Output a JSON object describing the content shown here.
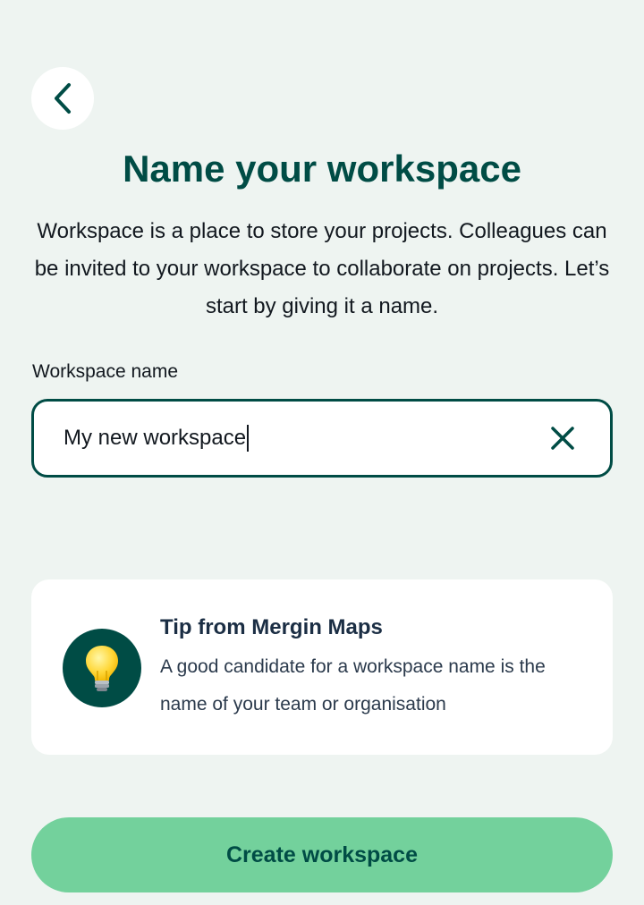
{
  "header": {
    "back_icon": "chevron-left-icon",
    "title": "Name your workspace",
    "description": "Workspace is a place to store your projects. Colleagues can be invited to your workspace to collaborate on projects. Let’s start by giving it a name."
  },
  "form": {
    "label": "Workspace name",
    "value": "My new workspace",
    "clear_icon": "close-icon"
  },
  "tip": {
    "icon": "lightbulb-icon",
    "title": "Tip from Mergin Maps",
    "text": "A good candidate for a workspace name is the name of your team or organisation"
  },
  "actions": {
    "create_label": "Create workspace"
  },
  "colors": {
    "background": "#eef4f1",
    "primary": "#004c45",
    "accent": "#73d19c",
    "card": "#ffffff"
  }
}
